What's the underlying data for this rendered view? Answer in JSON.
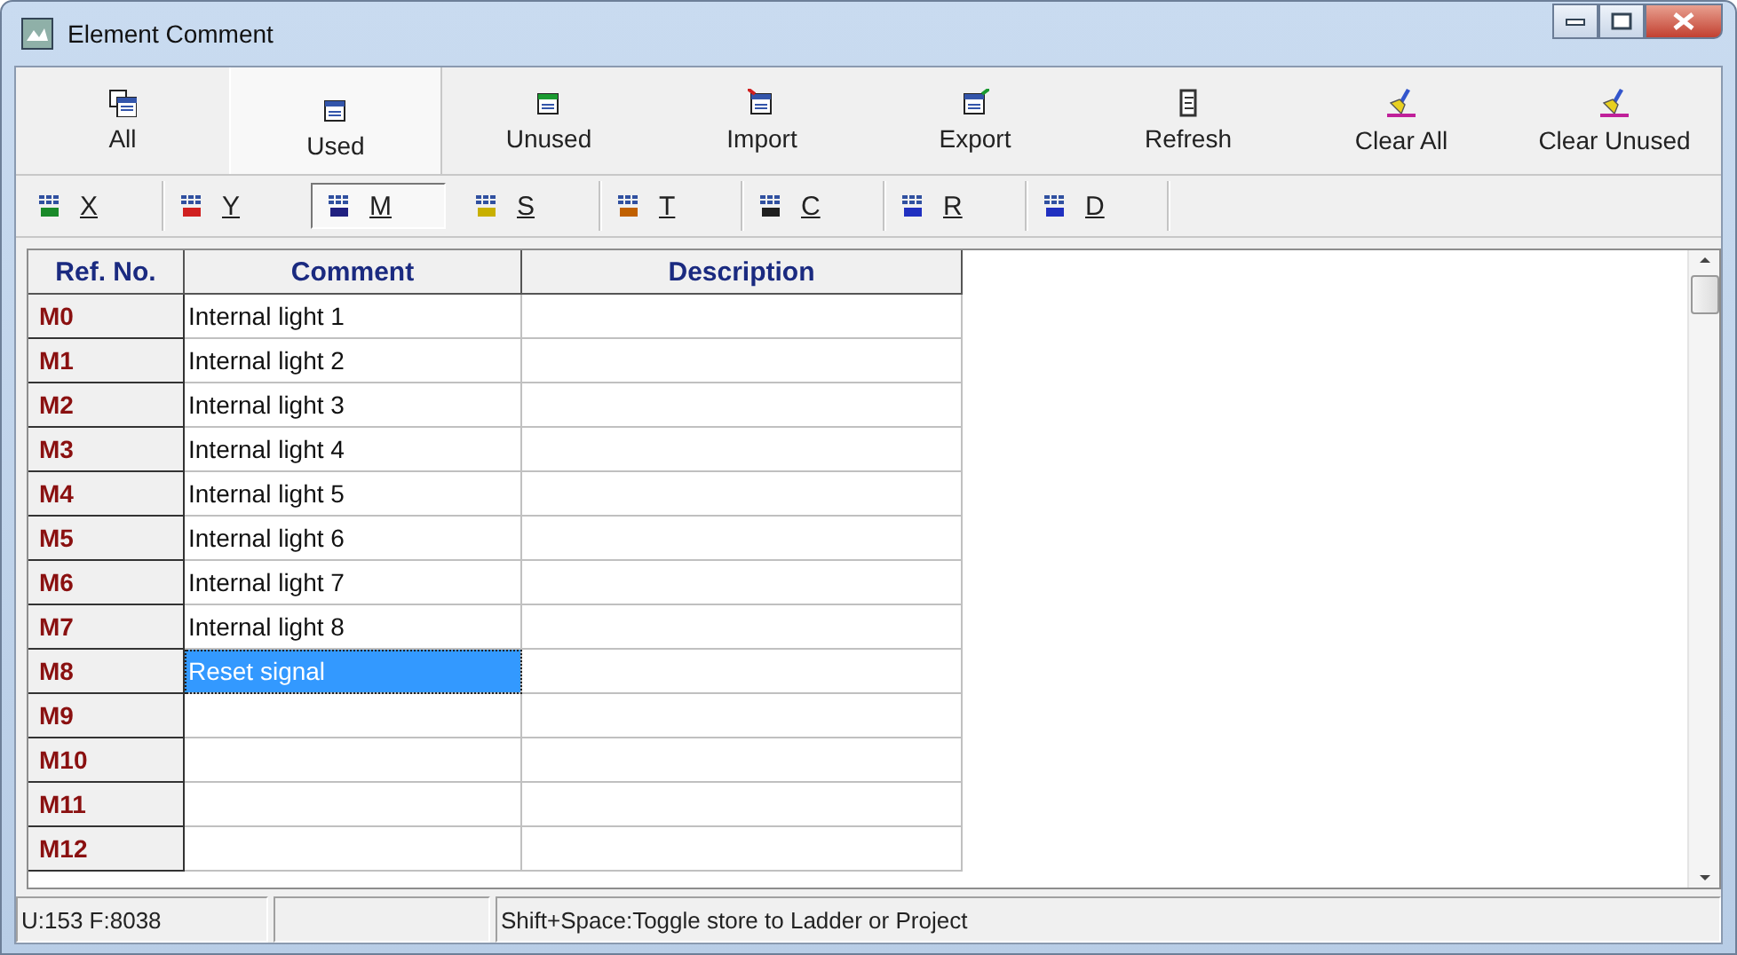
{
  "window": {
    "title": "Element Comment"
  },
  "toolbar": [
    {
      "label": "All",
      "selected": false
    },
    {
      "label": "Used",
      "selected": true
    },
    {
      "label": "Unused",
      "selected": false
    },
    {
      "label": "Import",
      "selected": false
    },
    {
      "label": "Export",
      "selected": false
    },
    {
      "label": "Refresh",
      "selected": false
    },
    {
      "label": "Clear All",
      "selected": false
    },
    {
      "label": "Clear Unused",
      "selected": false
    }
  ],
  "filters": [
    {
      "label": "X",
      "selected": false
    },
    {
      "label": "Y",
      "selected": false
    },
    {
      "label": "M",
      "selected": true
    },
    {
      "label": "S",
      "selected": false
    },
    {
      "label": "T",
      "selected": false
    },
    {
      "label": "C",
      "selected": false
    },
    {
      "label": "R",
      "selected": false
    },
    {
      "label": "D",
      "selected": false
    }
  ],
  "table": {
    "columns": [
      "Ref. No.",
      "Comment",
      "Description"
    ],
    "rows": [
      {
        "ref": "M0",
        "comment": "Internal light 1",
        "selected": false
      },
      {
        "ref": "M1",
        "comment": "Internal light 2",
        "selected": false
      },
      {
        "ref": "M2",
        "comment": "Internal light 3",
        "selected": false
      },
      {
        "ref": "M3",
        "comment": "Internal light 4",
        "selected": false
      },
      {
        "ref": "M4",
        "comment": "Internal light 5",
        "selected": false
      },
      {
        "ref": "M5",
        "comment": "Internal light 6",
        "selected": false
      },
      {
        "ref": "M6",
        "comment": "Internal light 7",
        "selected": false
      },
      {
        "ref": "M7",
        "comment": "Internal light 8",
        "selected": false
      },
      {
        "ref": "M8",
        "comment": "Reset signal",
        "selected": true
      },
      {
        "ref": "M9",
        "selected": false
      },
      {
        "ref": "M10",
        "selected": false
      },
      {
        "ref": "M11",
        "selected": false
      },
      {
        "ref": "M12",
        "selected": false
      }
    ]
  },
  "status_bar": {
    "counts": "U:153 F:8038",
    "hint": "Shift+Space:Toggle store to Ladder or Project"
  }
}
